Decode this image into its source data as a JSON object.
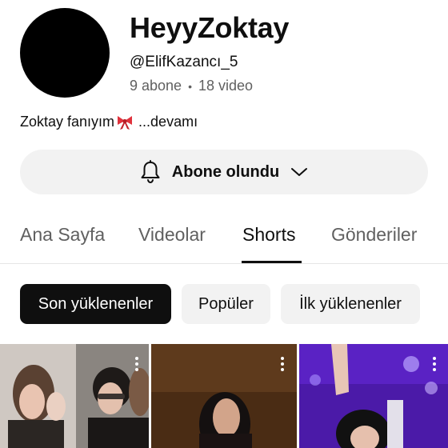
{
  "channel": {
    "name": "HeyyZoktay",
    "handle": "@ElifKazancı_5",
    "subscribers": "9 abone",
    "separator": "•",
    "videos": "18 video",
    "description": "Zoktay fanıyım",
    "description_more": "...devamı"
  },
  "subscribe_button": {
    "label": "Abone olundu",
    "icon": "bell-icon",
    "dropdown_icon": "chevron-down-icon"
  },
  "tabs": [
    {
      "label": "Ana Sayfa",
      "active": false
    },
    {
      "label": "Videolar",
      "active": false
    },
    {
      "label": "Shorts",
      "active": true
    },
    {
      "label": "Gönderiler",
      "active": false
    }
  ],
  "filters": [
    {
      "label": "Son yüklenenler",
      "active": true
    },
    {
      "label": "Popüler",
      "active": false
    },
    {
      "label": "İlk yüklenenler",
      "active": false
    }
  ],
  "colors": {
    "text": "#0f0f0f",
    "secondary_text": "#606060",
    "chip_background": "#f2f2f2",
    "active_chip_background": "#0f0f0f"
  }
}
